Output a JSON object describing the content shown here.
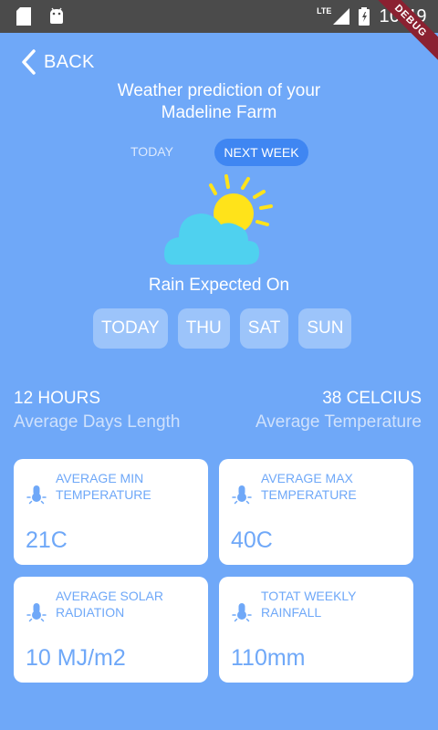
{
  "status_bar": {
    "time": "10:49",
    "network": "LTE"
  },
  "debug_banner": "DEBUG",
  "header": {
    "back_label": "BACK",
    "title_line1": "Weather prediction of your",
    "title_line2": "Madeline Farm"
  },
  "toggle": {
    "today": "TODAY",
    "next_week": "NEXT WEEK",
    "selected": "NEXT WEEK"
  },
  "weather_icon": "sun-behind-cloud-icon",
  "rain": {
    "title": "Rain Expected On",
    "days": [
      "TODAY",
      "THU",
      "SAT",
      "SUN"
    ]
  },
  "stats": {
    "left": {
      "value": "12 HOURS",
      "label": "Average Days Length"
    },
    "right": {
      "value": "38 CELCIUS",
      "label": "Average Temperature"
    }
  },
  "cards": [
    {
      "label_line1": "AVERAGE MIN",
      "label_line2": "TEMPERATURE",
      "value": "21C"
    },
    {
      "label_line1": "AVERAGE MAX",
      "label_line2": "TEMPERATURE",
      "value": "40C"
    },
    {
      "label_line1": "AVERAGE SOLAR",
      "label_line2": "RADIATION",
      "value": "10 MJ/m2"
    },
    {
      "label_line1": "TOTAT WEEKLY",
      "label_line2": "RAINFALL",
      "value": "110mm"
    }
  ],
  "colors": {
    "background": "#6FA8F8",
    "selected_chip": "#3F86F2",
    "day_chip": "#9CC4FA",
    "sun": "#FFE31A",
    "cloud": "#4FD1EF"
  }
}
